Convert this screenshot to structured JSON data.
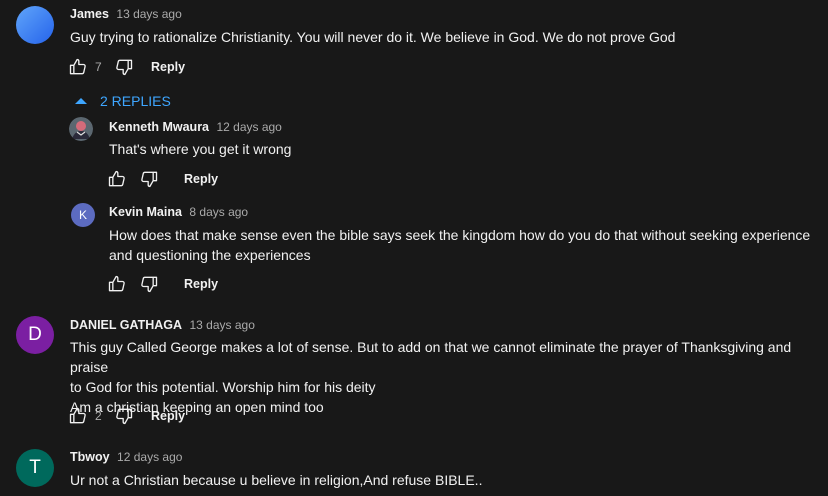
{
  "comments": [
    {
      "author": "James",
      "time": "13 days ago",
      "text": "Guy trying to rationalize Christianity. You will never do it. We believe in God. We do not prove God",
      "likes": "7",
      "reply_label": "Reply",
      "avatar_color": "#3b82f6",
      "avatar_letter": "",
      "replies_toggle": "2 REPLIES",
      "replies": [
        {
          "author": "Kenneth Mwaura",
          "time": "12 days ago",
          "text": "That's where you get it wrong",
          "likes": "",
          "reply_label": "Reply",
          "avatar_color": "#6b7280",
          "avatar_letter": ""
        },
        {
          "author": "Kevin Maina",
          "time": "8 days ago",
          "text": "How does that make sense even the bible says seek the kingdom how do you do that without seeking experience\nand questioning the experiences",
          "likes": "",
          "reply_label": "Reply",
          "avatar_color": "#5c6bc0",
          "avatar_letter": "K"
        }
      ]
    },
    {
      "author": "DANIEL GATHAGA",
      "time": "13 days ago",
      "text": "This guy Called George makes a lot of sense. But to add on that we cannot eliminate the prayer of Thanksgiving and praise\nto God for this potential.  Worship him for his deity\nAm a christian keeping an open mind too",
      "likes": "2",
      "reply_label": "Reply",
      "avatar_color": "#7b1fa2",
      "avatar_letter": "D"
    },
    {
      "author": "Tbwoy",
      "time": "12 days ago",
      "text": "Ur not a Christian because u believe in religion,And refuse BIBLE..",
      "likes": "",
      "reply_label": "Reply",
      "avatar_color": "#00695c",
      "avatar_letter": "T"
    }
  ],
  "icons": {
    "like": "thumbs-up-icon",
    "dislike": "thumbs-down-icon",
    "collapse": "caret-up-icon"
  },
  "colors": {
    "background": "#181818",
    "link": "#3ea6ff",
    "secondary_text": "#aaaaaa"
  }
}
